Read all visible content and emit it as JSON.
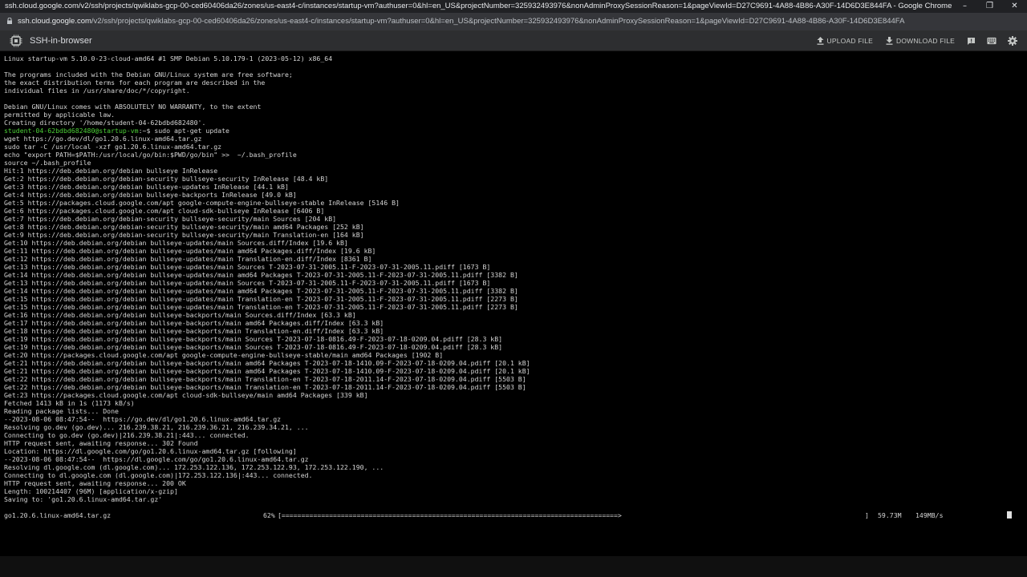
{
  "window": {
    "title": "ssh.cloud.google.com/v2/ssh/projects/qwiklabs-gcp-00-ced60406da26/zones/us-east4-c/instances/startup-vm?authuser=0&hl=en_US&projectNumber=325932493976&nonAdminProxySessionReason=1&pageViewId=D27C9691-4A88-4B86-A30F-14D6D3E844FA - Google Chrome",
    "url_host": "ssh.cloud.google.com",
    "url_path": "/v2/ssh/projects/qwiklabs-gcp-00-ced60406da26/zones/us-east4-c/instances/startup-vm?authuser=0&hl=en_US&projectNumber=325932493976&nonAdminProxySessionReason=1&pageViewId=D27C9691-4A88-4B86-A30F-14D6D3E844FA"
  },
  "app": {
    "title": "SSH-in-browser",
    "upload_label": "UPLOAD FILE",
    "download_label": "DOWNLOAD FILE"
  },
  "terminal": {
    "prompt_user": "student-04-62bdbd682480@startup-vm",
    "prompt_rest": ":~$ sudo apt-get update",
    "lines_before": [
      "Linux startup-vm 5.10.0-23-cloud-amd64 #1 SMP Debian 5.10.179-1 (2023-05-12) x86_64",
      "",
      "The programs included with the Debian GNU/Linux system are free software;",
      "the exact distribution terms for each program are described in the",
      "individual files in /usr/share/doc/*/copyright.",
      "",
      "Debian GNU/Linux comes with ABSOLUTELY NO WARRANTY, to the extent",
      "permitted by applicable law.",
      "Creating directory '/home/student-04-62bdbd682480'."
    ],
    "lines_after": [
      "wget https://go.dev/dl/go1.20.6.linux-amd64.tar.gz",
      "sudo tar -C /usr/local -xzf go1.20.6.linux-amd64.tar.gz",
      "echo \"export PATH=$PATH:/usr/local/go/bin:$PWD/go/bin\" >>  ~/.bash_profile",
      "source ~/.bash_profile",
      "Hit:1 https://deb.debian.org/debian bullseye InRelease",
      "Get:2 https://deb.debian.org/debian-security bullseye-security InRelease [48.4 kB]",
      "Get:3 https://deb.debian.org/debian bullseye-updates InRelease [44.1 kB]",
      "Get:4 https://deb.debian.org/debian bullseye-backports InRelease [49.0 kB]",
      "Get:5 https://packages.cloud.google.com/apt google-compute-engine-bullseye-stable InRelease [5146 B]",
      "Get:6 https://packages.cloud.google.com/apt cloud-sdk-bullseye InRelease [6406 B]",
      "Get:7 https://deb.debian.org/debian-security bullseye-security/main Sources [204 kB]",
      "Get:8 https://deb.debian.org/debian-security bullseye-security/main amd64 Packages [252 kB]",
      "Get:9 https://deb.debian.org/debian-security bullseye-security/main Translation-en [164 kB]",
      "Get:10 https://deb.debian.org/debian bullseye-updates/main Sources.diff/Index [19.6 kB]",
      "Get:11 https://deb.debian.org/debian bullseye-updates/main amd64 Packages.diff/Index [19.6 kB]",
      "Get:12 https://deb.debian.org/debian bullseye-updates/main Translation-en.diff/Index [8361 B]",
      "Get:13 https://deb.debian.org/debian bullseye-updates/main Sources T-2023-07-31-2005.11-F-2023-07-31-2005.11.pdiff [1673 B]",
      "Get:14 https://deb.debian.org/debian bullseye-updates/main amd64 Packages T-2023-07-31-2005.11-F-2023-07-31-2005.11.pdiff [3382 B]",
      "Get:13 https://deb.debian.org/debian bullseye-updates/main Sources T-2023-07-31-2005.11-F-2023-07-31-2005.11.pdiff [1673 B]",
      "Get:14 https://deb.debian.org/debian bullseye-updates/main amd64 Packages T-2023-07-31-2005.11-F-2023-07-31-2005.11.pdiff [3382 B]",
      "Get:15 https://deb.debian.org/debian bullseye-updates/main Translation-en T-2023-07-31-2005.11-F-2023-07-31-2005.11.pdiff [2273 B]",
      "Get:15 https://deb.debian.org/debian bullseye-updates/main Translation-en T-2023-07-31-2005.11-F-2023-07-31-2005.11.pdiff [2273 B]",
      "Get:16 https://deb.debian.org/debian bullseye-backports/main Sources.diff/Index [63.3 kB]",
      "Get:17 https://deb.debian.org/debian bullseye-backports/main amd64 Packages.diff/Index [63.3 kB]",
      "Get:18 https://deb.debian.org/debian bullseye-backports/main Translation-en.diff/Index [63.3 kB]",
      "Get:19 https://deb.debian.org/debian bullseye-backports/main Sources T-2023-07-18-0816.49-F-2023-07-18-0209.04.pdiff [28.3 kB]",
      "Get:19 https://deb.debian.org/debian bullseye-backports/main Sources T-2023-07-18-0816.49-F-2023-07-18-0209.04.pdiff [28.3 kB]",
      "Get:20 https://packages.cloud.google.com/apt google-compute-engine-bullseye-stable/main amd64 Packages [1902 B]",
      "Get:21 https://deb.debian.org/debian bullseye-backports/main amd64 Packages T-2023-07-18-1410.09-F-2023-07-18-0209.04.pdiff [20.1 kB]",
      "Get:21 https://deb.debian.org/debian bullseye-backports/main amd64 Packages T-2023-07-18-1410.09-F-2023-07-18-0209.04.pdiff [20.1 kB]",
      "Get:22 https://deb.debian.org/debian bullseye-backports/main Translation-en T-2023-07-18-2011.14-F-2023-07-18-0209.04.pdiff [5503 B]",
      "Get:22 https://deb.debian.org/debian bullseye-backports/main Translation-en T-2023-07-18-2011.14-F-2023-07-18-0209.04.pdiff [5503 B]",
      "Get:23 https://packages.cloud.google.com/apt cloud-sdk-bullseye/main amd64 Packages [339 kB]",
      "Fetched 1413 kB in 1s (1173 kB/s)",
      "Reading package lists... Done",
      "--2023-08-06 08:47:54--  https://go.dev/dl/go1.20.6.linux-amd64.tar.gz",
      "Resolving go.dev (go.dev)... 216.239.38.21, 216.239.36.21, 216.239.34.21, ...",
      "Connecting to go.dev (go.dev)|216.239.38.21|:443... connected.",
      "HTTP request sent, awaiting response... 302 Found",
      "Location: https://dl.google.com/go/go1.20.6.linux-amd64.tar.gz [following]",
      "--2023-08-06 08:47:54--  https://dl.google.com/go/go1.20.6.linux-amd64.tar.gz",
      "Resolving dl.google.com (dl.google.com)... 172.253.122.136, 172.253.122.93, 172.253.122.190, ...",
      "Connecting to dl.google.com (dl.google.com)|172.253.122.136|:443... connected.",
      "HTTP request sent, awaiting response... 200 OK",
      "Length: 100214407 (96M) [application/x-gzip]",
      "Saving to: 'go1.20.6.linux-amd64.tar.gz'"
    ],
    "progress": {
      "filename": "go1.20.6.linux-amd64.tar.gz",
      "percent_text": "62%",
      "bar_text": "[=====================================================================================>",
      "bar_end": "]",
      "size": "59.73M",
      "speed": "149MB/s"
    }
  }
}
